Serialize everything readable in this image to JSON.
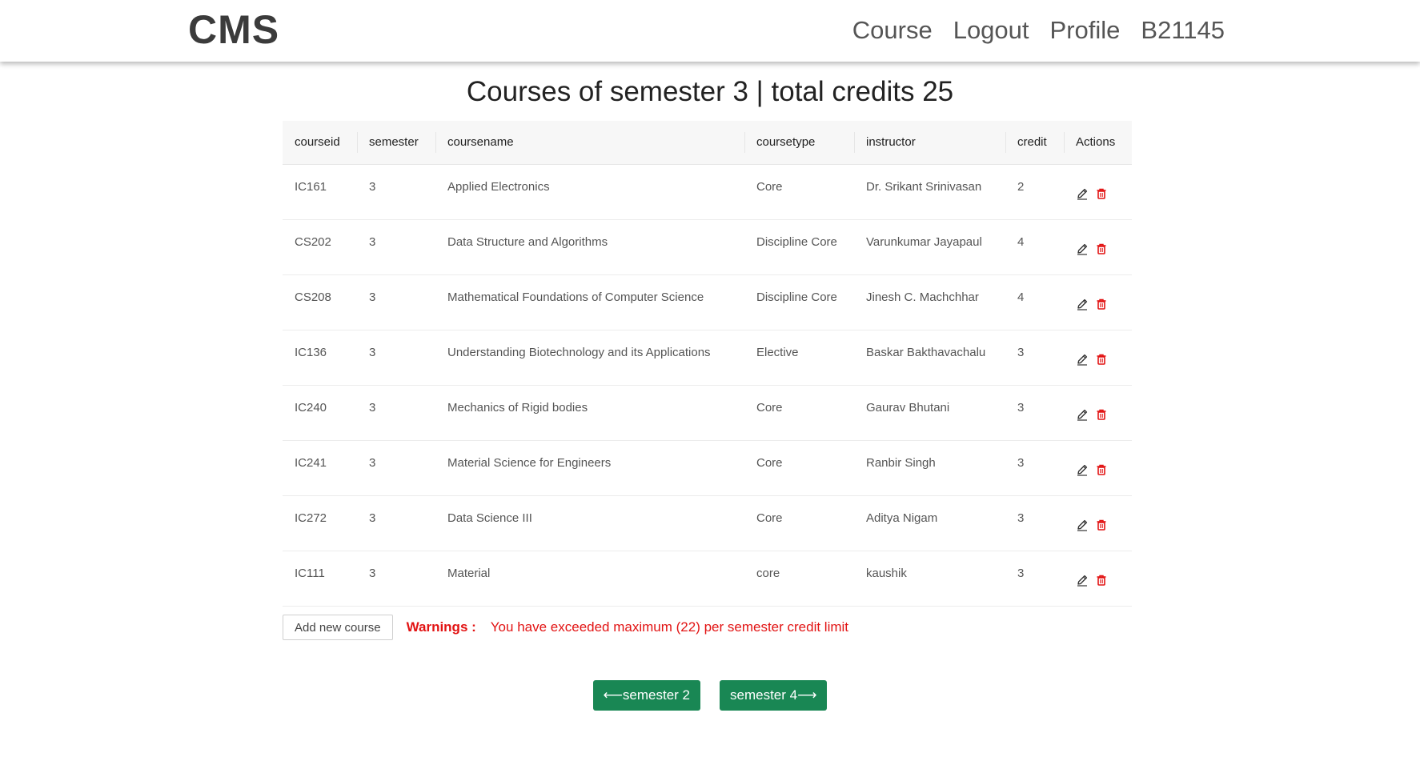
{
  "nav": {
    "brand": "CMS",
    "links": [
      "Course",
      "Logout",
      "Profile",
      "B21145"
    ]
  },
  "title": "Courses of semester 3 | total credits 25",
  "table": {
    "headers": [
      "courseid",
      "semester",
      "coursename",
      "coursetype",
      "instructor",
      "credit",
      "Actions"
    ],
    "rows": [
      [
        "IC161",
        "3",
        "Applied Electronics",
        "Core",
        "Dr. Srikant Srinivasan",
        "2"
      ],
      [
        "CS202",
        "3",
        "Data Structure and Algorithms",
        "Discipline Core",
        "Varunkumar Jayapaul",
        "4"
      ],
      [
        "CS208",
        "3",
        "Mathematical Foundations of Computer Science",
        "Discipline Core",
        "Jinesh C. Machchhar",
        "4"
      ],
      [
        "IC136",
        "3",
        "Understanding Biotechnology and its Applications",
        "Elective",
        "Baskar Bakthavachalu",
        "3"
      ],
      [
        "IC240",
        "3",
        "Mechanics of Rigid bodies",
        "Core",
        "Gaurav Bhutani",
        "3"
      ],
      [
        "IC241",
        "3",
        "Material Science for Engineers",
        "Core",
        "Ranbir Singh",
        "3"
      ],
      [
        "IC272",
        "3",
        "Data Science III",
        "Core",
        "Aditya Nigam",
        "3"
      ],
      [
        "IC111",
        "3",
        "Material",
        "core",
        "kaushik",
        "3"
      ]
    ],
    "edit_icon": "pencil-icon",
    "delete_icon": "trash-icon"
  },
  "footer": {
    "add_label": "Add new course",
    "warning_label": "Warnings :",
    "warning_text": "You have exceeded maximum (22) per semester credit limit"
  },
  "pager": {
    "prev_label": "⟵semester 2",
    "next_label": "semester 4⟶"
  },
  "colors": {
    "warning": "#e21313",
    "button_green": "#198754",
    "delete_red": "#e21313"
  }
}
